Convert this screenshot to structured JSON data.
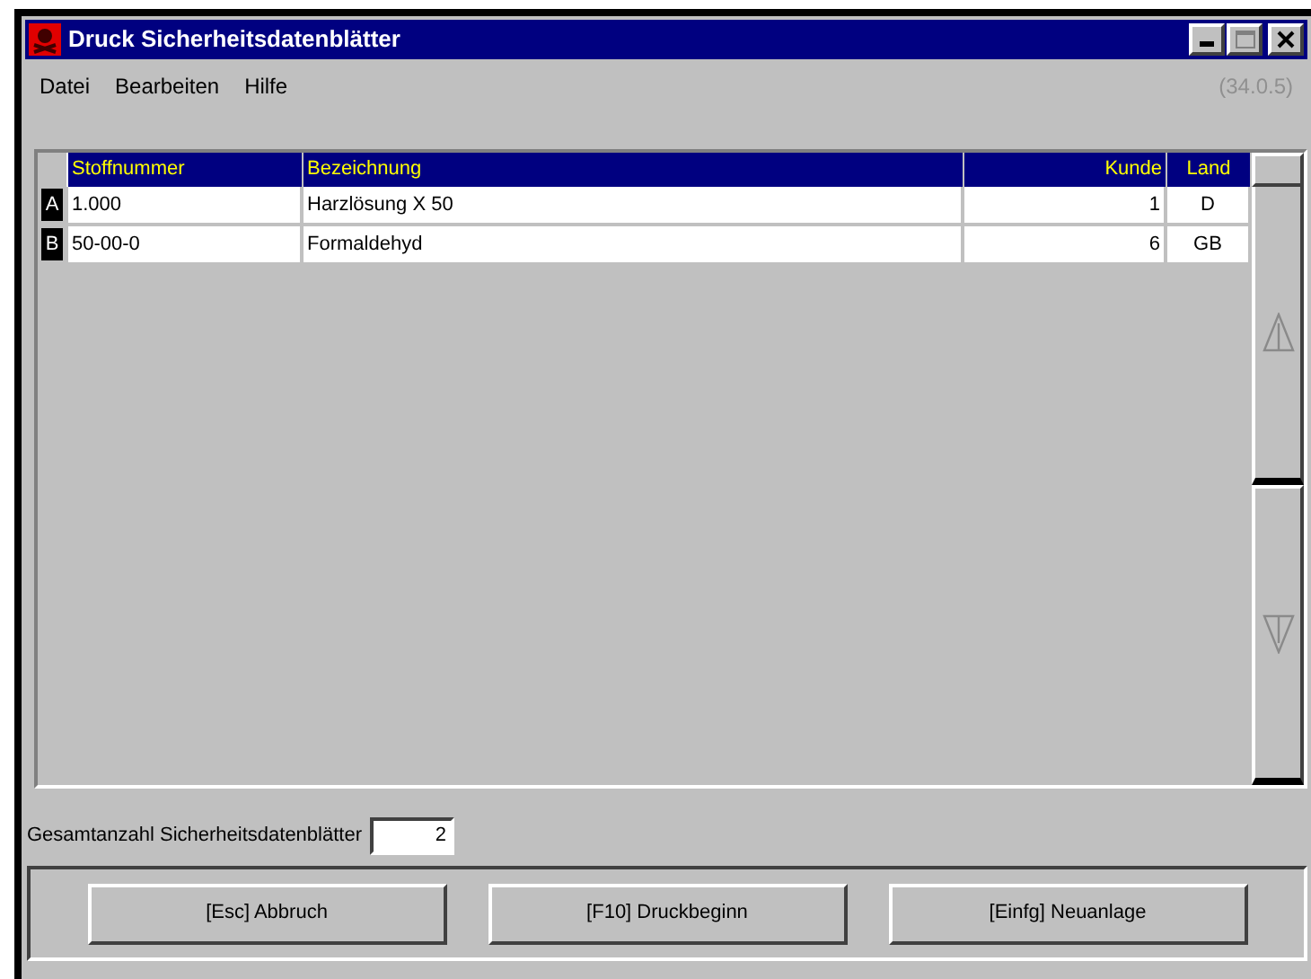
{
  "window": {
    "title": "Druck Sicherheitsdatenblätter",
    "version": "(34.0.5)"
  },
  "menu": [
    "Datei",
    "Bearbeiten",
    "Hilfe"
  ],
  "table": {
    "columns": [
      "Stoffnummer",
      "Bezeichnung",
      "Kunde",
      "Land"
    ],
    "rows": [
      {
        "marker": "A",
        "cells": [
          "1.000",
          "Harzlösung X 50",
          "1",
          "D"
        ]
      },
      {
        "marker": "B",
        "cells": [
          "50-00-0",
          "Formaldehyd",
          "6",
          "GB"
        ]
      }
    ]
  },
  "total": {
    "label": "Gesamtanzahl Sicherheitsdatenblätter",
    "value": "2"
  },
  "buttons": [
    "[Esc] Abbruch",
    "[F10] Druckbeginn",
    "[Einfg] Neuanlage"
  ]
}
